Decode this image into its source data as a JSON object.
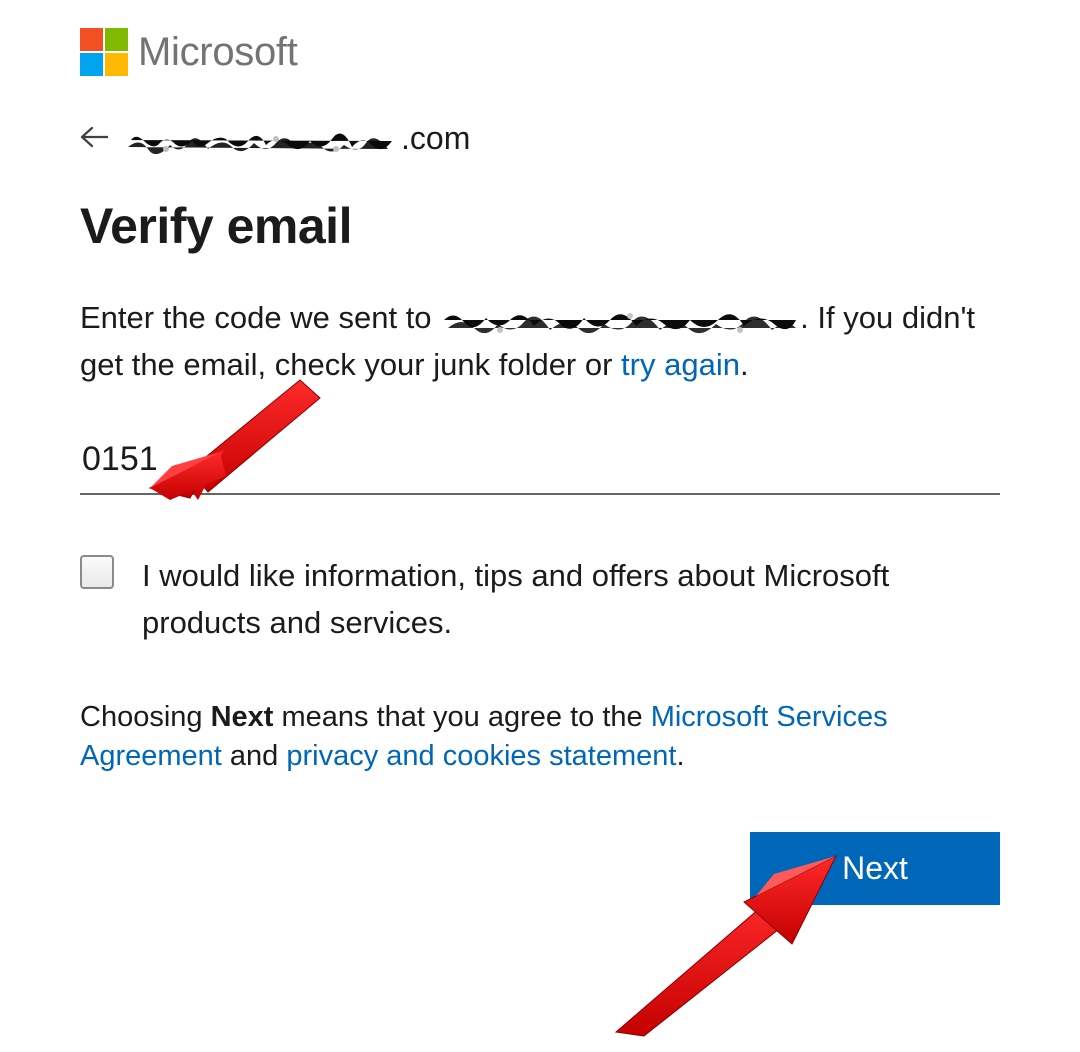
{
  "brand": {
    "name": "Microsoft"
  },
  "identity": {
    "email_visible_suffix": ".com"
  },
  "title": "Verify email",
  "instruction": {
    "prefix": "Enter the code we sent to ",
    "suffix_before_link": ". If you didn't get the email, check your junk folder or ",
    "try_again": "try again",
    "period": "."
  },
  "code": {
    "value": "0151"
  },
  "consent": {
    "label": "I would like information, tips and offers about Microsoft products and services."
  },
  "terms": {
    "prefix": "Choosing ",
    "bold": "Next",
    "mid": " means that you agree to the ",
    "link1": "Microsoft Services Agreement",
    "and": " and ",
    "link2": "privacy and cookies statement",
    "period": "."
  },
  "actions": {
    "next_label": "Next"
  }
}
